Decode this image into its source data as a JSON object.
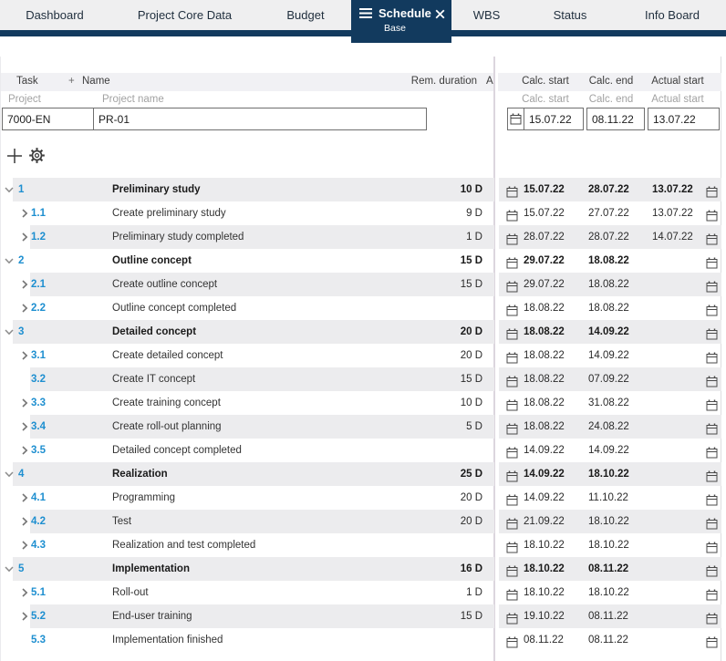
{
  "colors": {
    "navy": "#123a5e",
    "accent_blue": "#1e8fd0",
    "row_stripe": "#ececee",
    "header_bg": "#f1f1f4",
    "tabbar_bg": "#efeff0",
    "input_border": "#6f6f6f"
  },
  "icons": {
    "tab_menu": "hamburger-menu-icon",
    "tab_close": "close-icon",
    "toolbar_add": "plus-icon",
    "toolbar_settings": "gear-icon",
    "expand_parent": "chevron-down-icon",
    "expand_child": "chevron-right-icon",
    "date_picker": "calendar-icon"
  },
  "tabs": [
    {
      "label": "Dashboard",
      "active": false
    },
    {
      "label": "Project Core Data",
      "active": false
    },
    {
      "label": "Budget",
      "active": false
    },
    {
      "label": "Schedule",
      "active": true,
      "sublabel": "Base"
    },
    {
      "label": "WBS",
      "active": false
    },
    {
      "label": "Status",
      "active": false
    },
    {
      "label": "Info Board",
      "active": false
    }
  ],
  "columns": {
    "task": "Task",
    "plus": "+",
    "name": "Name",
    "rem_duration": "Rem. duration",
    "a": "A",
    "calc_start": "Calc. start",
    "calc_end": "Calc. end",
    "actual_start": "Actual start"
  },
  "subheader": {
    "project": "Project",
    "project_name": "Project name",
    "calc_start": "Calc. start",
    "calc_end": "Calc. end",
    "actual_start": "Actual start"
  },
  "project_row": {
    "id": "7000-EN",
    "name": "PR-01",
    "calc_start": "15.07.22",
    "calc_end": "08.11.22",
    "actual_start": "13.07.22"
  },
  "rows": [
    {
      "num": "1",
      "name": "Preliminary study",
      "dur": "10 D",
      "calc_start": "15.07.22",
      "calc_end": "28.07.22",
      "actual_start": "13.07.22",
      "level": 0,
      "chevron": "down",
      "bold": true
    },
    {
      "num": "1.1",
      "name": "Create preliminary study",
      "dur": "9 D",
      "calc_start": "15.07.22",
      "calc_end": "27.07.22",
      "actual_start": "13.07.22",
      "level": 1,
      "chevron": "right",
      "bold": false
    },
    {
      "num": "1.2",
      "name": "Preliminary study completed",
      "dur": "1 D",
      "calc_start": "28.07.22",
      "calc_end": "28.07.22",
      "actual_start": "14.07.22",
      "level": 1,
      "chevron": "right",
      "bold": false
    },
    {
      "num": "2",
      "name": "Outline concept",
      "dur": "15 D",
      "calc_start": "29.07.22",
      "calc_end": "18.08.22",
      "actual_start": "",
      "level": 0,
      "chevron": "down",
      "bold": true
    },
    {
      "num": "2.1",
      "name": "Create outline concept",
      "dur": "15 D",
      "calc_start": "29.07.22",
      "calc_end": "18.08.22",
      "actual_start": "",
      "level": 1,
      "chevron": "right",
      "bold": false
    },
    {
      "num": "2.2",
      "name": "Outline concept completed",
      "dur": "",
      "calc_start": "18.08.22",
      "calc_end": "18.08.22",
      "actual_start": "",
      "level": 1,
      "chevron": "right",
      "bold": false
    },
    {
      "num": "3",
      "name": "Detailed concept",
      "dur": "20 D",
      "calc_start": "18.08.22",
      "calc_end": "14.09.22",
      "actual_start": "",
      "level": 0,
      "chevron": "down",
      "bold": true
    },
    {
      "num": "3.1",
      "name": "Create detailed concept",
      "dur": "20 D",
      "calc_start": "18.08.22",
      "calc_end": "14.09.22",
      "actual_start": "",
      "level": 1,
      "chevron": "right",
      "bold": false
    },
    {
      "num": "3.2",
      "name": "Create IT concept",
      "dur": "15 D",
      "calc_start": "18.08.22",
      "calc_end": "07.09.22",
      "actual_start": "",
      "level": 1,
      "chevron": "none",
      "bold": false
    },
    {
      "num": "3.3",
      "name": "Create training concept",
      "dur": "10 D",
      "calc_start": "18.08.22",
      "calc_end": "31.08.22",
      "actual_start": "",
      "level": 1,
      "chevron": "right",
      "bold": false
    },
    {
      "num": "3.4",
      "name": "Create roll-out planning",
      "dur": "5 D",
      "calc_start": "18.08.22",
      "calc_end": "24.08.22",
      "actual_start": "",
      "level": 1,
      "chevron": "right",
      "bold": false
    },
    {
      "num": "3.5",
      "name": "Detailed concept completed",
      "dur": "",
      "calc_start": "14.09.22",
      "calc_end": "14.09.22",
      "actual_start": "",
      "level": 1,
      "chevron": "right",
      "bold": false
    },
    {
      "num": "4",
      "name": "Realization",
      "dur": "25 D",
      "calc_start": "14.09.22",
      "calc_end": "18.10.22",
      "actual_start": "",
      "level": 0,
      "chevron": "down",
      "bold": true
    },
    {
      "num": "4.1",
      "name": "Programming",
      "dur": "20 D",
      "calc_start": "14.09.22",
      "calc_end": "11.10.22",
      "actual_start": "",
      "level": 1,
      "chevron": "right",
      "bold": false
    },
    {
      "num": "4.2",
      "name": "Test",
      "dur": "20 D",
      "calc_start": "21.09.22",
      "calc_end": "18.10.22",
      "actual_start": "",
      "level": 1,
      "chevron": "right",
      "bold": false
    },
    {
      "num": "4.3",
      "name": "Realization and test completed",
      "dur": "",
      "calc_start": "18.10.22",
      "calc_end": "18.10.22",
      "actual_start": "",
      "level": 1,
      "chevron": "right",
      "bold": false
    },
    {
      "num": "5",
      "name": "Implementation",
      "dur": "16 D",
      "calc_start": "18.10.22",
      "calc_end": "08.11.22",
      "actual_start": "",
      "level": 0,
      "chevron": "down",
      "bold": true
    },
    {
      "num": "5.1",
      "name": "Roll-out",
      "dur": "1 D",
      "calc_start": "18.10.22",
      "calc_end": "18.10.22",
      "actual_start": "",
      "level": 1,
      "chevron": "right",
      "bold": false
    },
    {
      "num": "5.2",
      "name": "End-user training",
      "dur": "15 D",
      "calc_start": "19.10.22",
      "calc_end": "08.11.22",
      "actual_start": "",
      "level": 1,
      "chevron": "right",
      "bold": false
    },
    {
      "num": "5.3",
      "name": "Implementation finished",
      "dur": "",
      "calc_start": "08.11.22",
      "calc_end": "08.11.22",
      "actual_start": "",
      "level": 1,
      "chevron": "none",
      "bold": false
    }
  ]
}
